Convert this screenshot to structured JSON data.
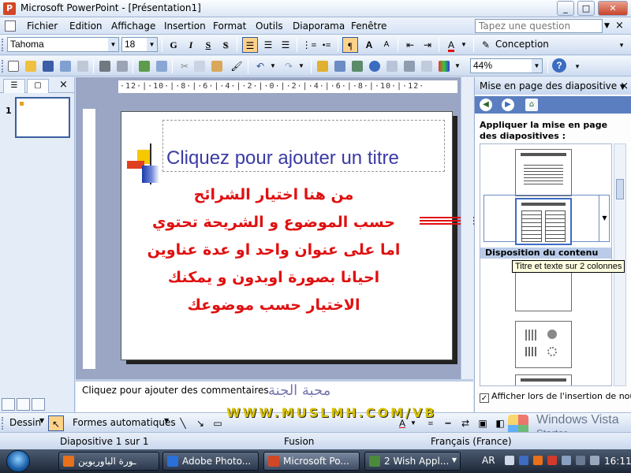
{
  "window": {
    "title": "Microsoft PowerPoint - [Présentation1]",
    "controls": {
      "minimize": "_",
      "maximize": "□",
      "close": "✕"
    }
  },
  "menu": {
    "items": [
      "Fichier",
      "Edition",
      "Affichage",
      "Insertion",
      "Format",
      "Outils",
      "Diaporama",
      "Fenêtre"
    ],
    "question_placeholder": "Tapez une question",
    "close_doc": "×"
  },
  "format_toolbar": {
    "font": "Tahoma",
    "size": "18",
    "bold": "G",
    "italic": "I",
    "underline": "S",
    "shadow": "S",
    "increase_font": "A",
    "decrease_font": "A",
    "design_label": "Conception"
  },
  "standard_toolbar": {
    "zoom": "44%",
    "help": "?"
  },
  "left_panel": {
    "slide_number": "1",
    "close": "×"
  },
  "slide": {
    "ruler_text": "·12·|·10·|·8·|·6·|·4·|·2·|·0·|·2·|·4·|·6·|·8·|·10·|·12·",
    "title_placeholder": "Cliquez pour ajouter un titre",
    "arabic_lines": [
      "من هنا اختيار الشرائح",
      "حسب الموضوع و الشريحة تحتوي",
      "اما على عنوان واحد او عدة عناوين",
      "احيانا بصورة اوبدون و يمكنك",
      "الاختيار حسب موضوعك"
    ]
  },
  "notes": {
    "placeholder": "Cliquez pour ajouter des commentaires"
  },
  "watermark": {
    "arabic": "محبة الجنة",
    "url": "WWW.MUSLMH.COM/VB"
  },
  "task_pane": {
    "title": "Mise en page des diapositive",
    "apply_label": "Appliquer la mise en page des diapositives :",
    "section_content": "Disposition du contenu",
    "tooltip": "Titre et texte sur 2 colonnes",
    "checkbox_label": "Afficher lors de l'insertion de nouvelle",
    "checkbox_checked": "✓",
    "close": "×"
  },
  "drawing_toolbar": {
    "draw_label": "Dessin",
    "autoshapes_label": "Formes automatiques"
  },
  "vista_watermark": {
    "line1": "Windows Vista",
    "line2": "Starter"
  },
  "status_bar": {
    "slide_info": "Diapositive 1 sur 1",
    "design": "Fusion",
    "language": "Français (France)"
  },
  "taskbar": {
    "buttons": [
      {
        "label": "ـورة الباوربوين",
        "color": "#e8701a"
      },
      {
        "label": "Adobe Photo...",
        "color": "#2a6fd6"
      },
      {
        "label": "Microsoft Po...",
        "color": "#d24726"
      },
      {
        "label": "2 Wish Appl...",
        "color": "#4a8a3a"
      }
    ],
    "lang": "AR",
    "clock": "16:11"
  },
  "colors": {
    "accent": "#3a3aa6",
    "arabic_text": "#e01010",
    "slide_bg": "#ffffff",
    "workspace": "#9aa6c4"
  }
}
